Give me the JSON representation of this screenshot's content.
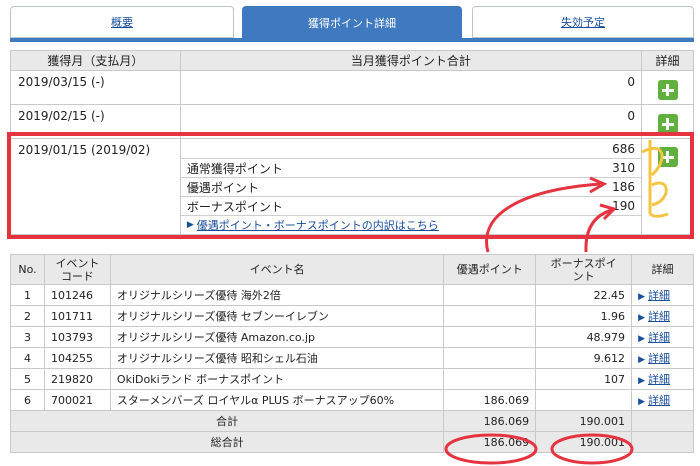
{
  "tabs": [
    {
      "label": "概要",
      "active": false
    },
    {
      "label": "獲得ポイント詳細",
      "active": true
    },
    {
      "label": "失効予定",
      "active": false
    }
  ],
  "monthly": {
    "headers": {
      "month": "獲得月（支払月）",
      "total": "当月獲得ポイント合計",
      "detail": "詳細"
    },
    "rows": [
      {
        "month": "2019/03/15 (-)",
        "total": "0"
      },
      {
        "month": "2019/02/15 (-)",
        "total": "0"
      },
      {
        "month": "2019/01/15 (2019/02)",
        "total": "686"
      }
    ],
    "breakdown": [
      {
        "label": "通常獲得ポイント",
        "value": "310"
      },
      {
        "label": "優遇ポイント",
        "value": "186"
      },
      {
        "label": "ボーナスポイント",
        "value": "190"
      }
    ],
    "breakdown_link": "優遇ポイント・ボーナスポイントの内訳はこちら"
  },
  "events": {
    "headers": {
      "no": "No.",
      "code_line1": "イベント",
      "code_line2": "コード",
      "name": "イベント名",
      "preferred": "優遇ポイント",
      "bonus_line1": "ボーナスポイ",
      "bonus_line2": "ント",
      "detail": "詳細"
    },
    "detail_label": "詳細",
    "rows": [
      {
        "no": "1",
        "code": "101246",
        "name": "オリジナルシリーズ優待 海外2倍",
        "preferred": "",
        "bonus": "22.45"
      },
      {
        "no": "2",
        "code": "101711",
        "name": "オリジナルシリーズ優待 セブンーイレブン",
        "preferred": "",
        "bonus": "1.96"
      },
      {
        "no": "3",
        "code": "103793",
        "name": "オリジナルシリーズ優待 Amazon.co.jp",
        "preferred": "",
        "bonus": "48.979"
      },
      {
        "no": "4",
        "code": "104255",
        "name": "オリジナルシリーズ優待 昭和シェル石油",
        "preferred": "",
        "bonus": "9.612"
      },
      {
        "no": "5",
        "code": "219820",
        "name": "OkiDokiランド ボーナスポイント",
        "preferred": "",
        "bonus": "107"
      },
      {
        "no": "6",
        "code": "700021",
        "name": "スターメンバーズ ロイヤルα PLUS ボーナスアップ60%",
        "preferred": "186.069",
        "bonus": ""
      }
    ],
    "subtotal": {
      "label": "合計",
      "preferred": "186.069",
      "bonus": "190.001"
    },
    "grand_total": {
      "label": "総合計",
      "preferred": "186.069",
      "bonus": "190.001"
    }
  },
  "annotation_colors": {
    "box": "#e53340",
    "circle": "#e53340",
    "bracket": "#f4c542",
    "green": "#5fb03d",
    "accent": "#3f79c0"
  }
}
